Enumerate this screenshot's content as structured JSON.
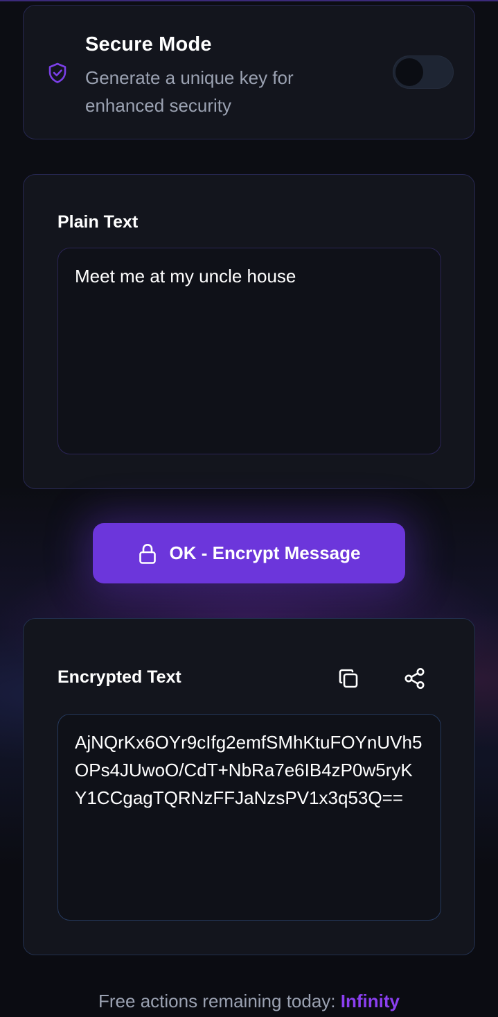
{
  "secure_mode": {
    "title": "Secure Mode",
    "description": "Generate a unique key for enhanced security",
    "enabled": false
  },
  "plain": {
    "label": "Plain Text",
    "value": "Meet me at my uncle house"
  },
  "action": {
    "encrypt_label": "OK - Encrypt Message"
  },
  "encrypted": {
    "label": "Encrypted Text",
    "value": "AjNQrKx6OYr9cIfg2emfSMhKtuFOYnUVh5OPs4JUwoO/CdT+NbRa7e6IB4zP0w5ryKY1CCgagTQRNzFFJaNzsPV1x3q53Q=="
  },
  "footer": {
    "prefix": "Free actions remaining today: ",
    "value": "Infinity"
  },
  "colors": {
    "accent": "#6c36db",
    "accent_text": "#8b3ff0"
  },
  "icons": [
    "shield-check-icon",
    "lock-icon",
    "copy-icon",
    "share-icon"
  ]
}
